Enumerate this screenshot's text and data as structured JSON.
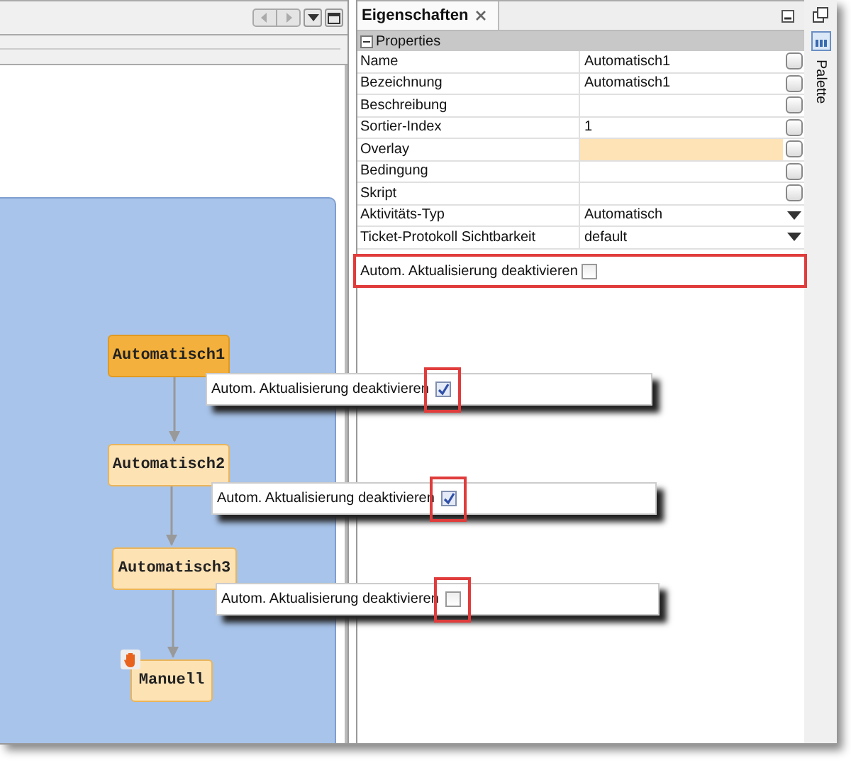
{
  "diagram": {
    "nodes": [
      {
        "label": "Automatisch1",
        "kind": "automatic",
        "selected": true
      },
      {
        "label": "Automatisch2",
        "kind": "automatic",
        "selected": false
      },
      {
        "label": "Automatisch3",
        "kind": "automatic",
        "selected": false
      },
      {
        "label": "Manuell",
        "kind": "manual",
        "selected": false
      }
    ]
  },
  "properties_view": {
    "title": "Eigenschaften",
    "section": {
      "label": "Properties",
      "expanded": true
    },
    "rows": [
      {
        "name": "Name",
        "value": "Automatisch1",
        "kind": "text",
        "highlighted": false
      },
      {
        "name": "Bezeichnung",
        "value": "Automatisch1",
        "kind": "text",
        "highlighted": false
      },
      {
        "name": "Beschreibung",
        "kind": "text",
        "highlighted": false
      },
      {
        "name": "Sortier-Index",
        "value": "1",
        "kind": "text",
        "highlighted": false
      },
      {
        "name": "Overlay",
        "kind": "text",
        "highlighted": true
      },
      {
        "name": "Bedingung",
        "kind": "text",
        "highlighted": false
      },
      {
        "name": "Skript",
        "kind": "text",
        "highlighted": false
      },
      {
        "name": "Aktivitäts-Typ",
        "value": "Automatisch",
        "kind": "dropdown",
        "highlighted": false
      },
      {
        "name": "Ticket-Protokoll Sichtbarkeit",
        "value": "default",
        "kind": "dropdown",
        "highlighted": false
      }
    ]
  },
  "palette": {
    "label": "Palette"
  },
  "callouts": [
    {
      "label": "Autom. Aktualisierung deaktivieren",
      "checked": false,
      "kind": "panel"
    },
    {
      "label": "Autom. Aktualisierung deaktivieren",
      "checked": true,
      "kind": "floating"
    },
    {
      "label": "Autom. Aktualisierung deaktivieren",
      "checked": true,
      "kind": "floating"
    },
    {
      "label": "Autom. Aktualisierung deaktivieren",
      "checked": false,
      "kind": "floating"
    }
  ]
}
